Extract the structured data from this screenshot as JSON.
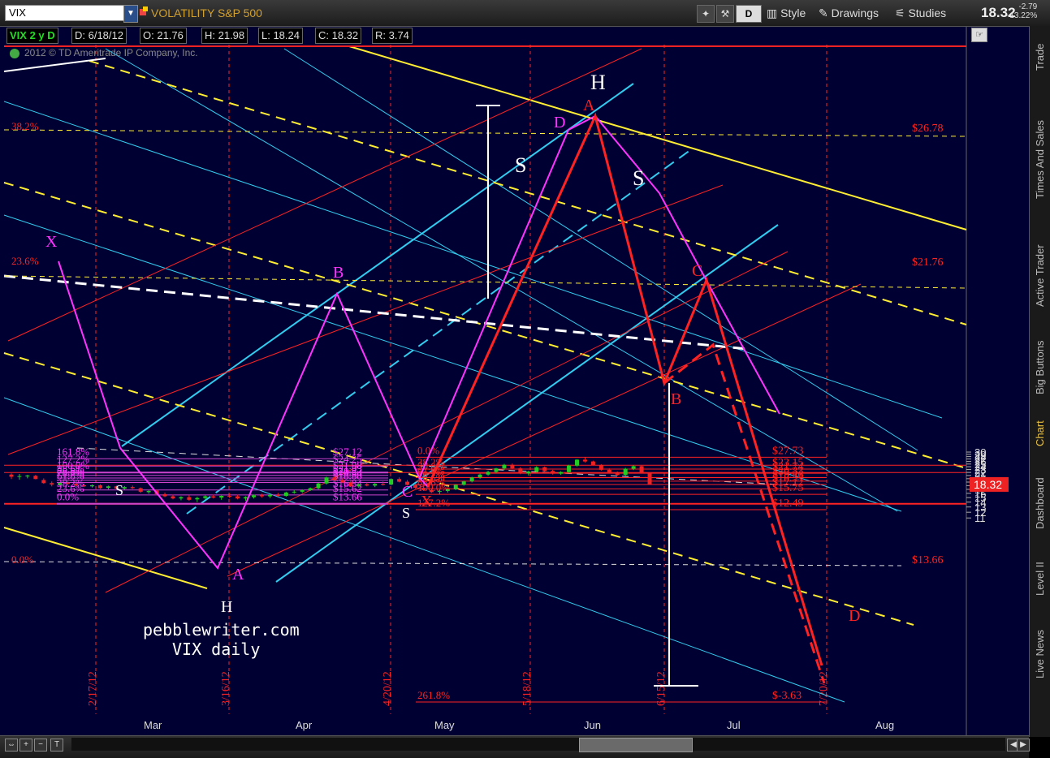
{
  "toolbar": {
    "symbol": "VIX",
    "description": "VOLATILITY S&P 500",
    "style_label": "Style",
    "drawings_label": "Drawings",
    "studies_label": "Studies",
    "last_price": "18.32",
    "net_change": "-2.79",
    "pct_change": "-13.22%",
    "d_button": "D"
  },
  "infobar": {
    "period": "VIX 2 y D",
    "date": "D: 6/18/12",
    "open": "O: 21.76",
    "high": "H: 21.98",
    "low": "L: 18.24",
    "close": "C: 18.32",
    "range": "R: 3.74"
  },
  "copyright": "2012 © TD Ameritrade IP Company, Inc.",
  "rail_tabs": [
    "Trade",
    "Times And Sales",
    "Active Trader",
    "Big Buttons",
    "Chart",
    "Dashboard",
    "Level II",
    "Live News"
  ],
  "colors": {
    "background": "#000033",
    "bull_candle": "#22cc22",
    "bear_candle": "#ee2222",
    "pattern_red": "#ff2222",
    "pattern_magenta": "#ff33ff",
    "channel_cyan": "#33ccee",
    "channel_yellow": "#ffee33",
    "annotation_white": "#ffffff",
    "fib_purple": "#cc44cc"
  },
  "chart_data": {
    "type": "candlestick",
    "title": "VIX daily",
    "watermark": "pebblewriter.com",
    "ylim": [
      11,
      30.5
    ],
    "y_ticks": [
      11,
      12,
      13,
      14,
      15,
      16,
      17,
      18,
      19,
      20,
      21,
      22,
      23,
      24,
      25,
      26,
      27,
      28,
      29,
      30
    ],
    "x_month_labels": [
      "Mar",
      "Apr",
      "May",
      "Jun",
      "Jul",
      "Aug"
    ],
    "x_date_labels": [
      "2/17/12",
      "3/16/12",
      "4/20/12",
      "5/18/12",
      "6/15/12",
      "7/20/12"
    ],
    "current_price_tag": "18.32",
    "fib_left_labels": [
      {
        "pct": "161.8%",
        "price": "$27.12",
        "value": 27.12
      },
      {
        "pct": "127.2%",
        "price": "$24.25",
        "value": 24.25
      },
      {
        "pct": "100.0%",
        "price": "$21.98",
        "value": 21.98
      },
      {
        "pct": "88.6%",
        "price": "$21.03",
        "value": 21.03
      },
      {
        "pct": "78.6%",
        "price": "$20.2",
        "value": 20.2
      },
      {
        "pct": "70.7%",
        "price": "$19.54",
        "value": 19.54
      },
      {
        "pct": "61.8%",
        "price": "$18.88",
        "value": 18.88
      },
      {
        "pct": "38.2%",
        "price": "$16.84",
        "value": 16.84
      },
      {
        "pct": "23.6%",
        "price": "$15.62",
        "value": 15.62
      },
      {
        "pct": "0.0%",
        "price": "$13.66",
        "value": 13.66
      }
    ],
    "fib_right_labels": [
      {
        "pct": "0.0%",
        "price": "$27.73",
        "value": 27.73
      },
      {
        "pct": "38.2%",
        "price": "$23.15",
        "value": 23.15
      },
      {
        "pct": "50.0%",
        "price": "$21.74",
        "value": 21.74
      },
      {
        "pct": "61.8%",
        "price": "$20.33",
        "value": 20.33
      },
      {
        "pct": "70.7%",
        "price": "$19.26",
        "value": 19.26
      },
      {
        "pct": "78.6%",
        "price": "$18.31",
        "value": 18.31
      },
      {
        "pct": "88.6%",
        "price": "$17.12",
        "value": 17.12
      },
      {
        "pct": "100.0%",
        "price": "$15.75",
        "value": 15.75
      },
      {
        "pct": "127.2%",
        "price": "$12.49",
        "value": 12.49
      },
      {
        "pct": "261.8%",
        "price": "$-3.63",
        "value": -3.63
      }
    ],
    "far_left_labels": [
      "38.2%",
      "23.6%",
      "0.0%"
    ],
    "far_right_prices": [
      "$26.78",
      "$21.76",
      "$13.66"
    ],
    "pattern_labels": {
      "left_pattern": [
        "X",
        "A",
        "B",
        "C",
        "D"
      ],
      "right_pattern": [
        "X",
        "A",
        "B",
        "C",
        "D"
      ],
      "head_shoulders": [
        "S",
        "H",
        "S"
      ],
      "inverse_hs": [
        "S",
        "H",
        "S"
      ]
    },
    "candles": [
      [
        21.3,
        21.7,
        19.9,
        20.6
      ],
      [
        20.6,
        21.5,
        19.7,
        20.8
      ],
      [
        20.7,
        21.2,
        20.1,
        21.0
      ],
      [
        20.9,
        21.2,
        19.8,
        19.9
      ],
      [
        19.6,
        20.1,
        18.5,
        18.7
      ],
      [
        18.7,
        19.2,
        17.8,
        18.3
      ],
      [
        18.2,
        19.0,
        17.9,
        18.8
      ],
      [
        18.8,
        19.3,
        18.1,
        18.5
      ],
      [
        18.5,
        19.1,
        17.9,
        18.0
      ],
      [
        18.1,
        18.6,
        17.6,
        17.8
      ],
      [
        17.8,
        18.3,
        17.5,
        18.1
      ],
      [
        18.1,
        18.4,
        17.1,
        17.3
      ],
      [
        17.4,
        18.0,
        17.0,
        17.8
      ],
      [
        17.8,
        18.0,
        17.0,
        17.2
      ],
      [
        17.2,
        17.9,
        16.9,
        17.6
      ],
      [
        17.6,
        18.0,
        17.1,
        17.3
      ],
      [
        17.3,
        17.5,
        16.1,
        16.4
      ],
      [
        16.3,
        16.8,
        15.9,
        16.6
      ],
      [
        16.7,
        17.0,
        15.7,
        15.8
      ],
      [
        15.8,
        16.2,
        15.1,
        15.3
      ],
      [
        15.3,
        15.7,
        14.6,
        14.8
      ],
      [
        14.8,
        15.3,
        14.4,
        15.1
      ],
      [
        15.1,
        15.6,
        14.3,
        14.5
      ],
      [
        14.6,
        15.2,
        14.0,
        14.9
      ],
      [
        14.9,
        15.5,
        14.6,
        15.3
      ],
      [
        15.3,
        15.7,
        14.8,
        15.0
      ],
      [
        15.0,
        15.5,
        14.5,
        15.4
      ],
      [
        15.4,
        15.9,
        14.9,
        15.2
      ],
      [
        15.3,
        15.7,
        14.6,
        14.8
      ],
      [
        14.8,
        15.3,
        14.3,
        15.1
      ],
      [
        15.1,
        15.7,
        14.8,
        15.5
      ],
      [
        15.5,
        15.9,
        15.0,
        15.3
      ],
      [
        15.3,
        15.8,
        14.9,
        15.6
      ],
      [
        15.6,
        16.1,
        15.2,
        15.4
      ],
      [
        15.4,
        16.4,
        15.2,
        16.2
      ],
      [
        16.2,
        16.8,
        15.9,
        16.4
      ],
      [
        16.4,
        17.0,
        16.1,
        16.8
      ],
      [
        16.8,
        17.5,
        16.6,
        17.3
      ],
      [
        17.3,
        18.8,
        17.0,
        18.6
      ],
      [
        18.6,
        20.6,
        18.3,
        20.4
      ],
      [
        20.4,
        21.0,
        19.3,
        19.6
      ],
      [
        19.6,
        20.2,
        18.7,
        18.9
      ],
      [
        18.9,
        19.5,
        17.6,
        17.8
      ],
      [
        17.8,
        18.6,
        17.4,
        18.4
      ],
      [
        18.4,
        18.9,
        17.8,
        18.0
      ],
      [
        18.0,
        18.7,
        17.6,
        18.5
      ],
      [
        18.5,
        19.2,
        18.0,
        18.2
      ],
      [
        18.3,
        20.1,
        18.1,
        19.9
      ],
      [
        19.9,
        20.4,
        18.9,
        19.1
      ],
      [
        19.1,
        19.6,
        18.0,
        18.2
      ],
      [
        18.2,
        18.6,
        17.2,
        17.4
      ],
      [
        17.4,
        17.9,
        16.6,
        16.8
      ],
      [
        16.8,
        17.3,
        16.1,
        16.3
      ],
      [
        16.4,
        16.9,
        15.8,
        16.6
      ],
      [
        16.6,
        17.2,
        16.2,
        17.0
      ],
      [
        17.0,
        18.4,
        16.8,
        18.2
      ],
      [
        18.2,
        19.4,
        18.0,
        19.2
      ],
      [
        19.2,
        20.6,
        18.9,
        20.4
      ],
      [
        20.4,
        21.6,
        20.0,
        21.3
      ],
      [
        21.3,
        22.6,
        20.9,
        22.2
      ],
      [
        22.2,
        23.6,
        21.8,
        23.4
      ],
      [
        23.4,
        25.1,
        22.8,
        24.7
      ],
      [
        24.7,
        25.2,
        23.0,
        23.4
      ],
      [
        23.4,
        23.9,
        21.4,
        21.7
      ],
      [
        21.7,
        22.6,
        21.0,
        22.3
      ],
      [
        22.3,
        24.2,
        22.0,
        23.8
      ],
      [
        23.8,
        24.1,
        22.3,
        22.5
      ],
      [
        22.5,
        22.9,
        21.3,
        21.6
      ],
      [
        21.6,
        22.4,
        21.2,
        22.1
      ],
      [
        22.1,
        24.7,
        21.9,
        24.4
      ],
      [
        24.4,
        26.9,
        24.1,
        26.7
      ],
      [
        26.7,
        27.73,
        25.6,
        26.0
      ],
      [
        26.0,
        26.3,
        24.4,
        24.6
      ],
      [
        24.6,
        24.9,
        22.6,
        22.9
      ],
      [
        22.9,
        23.4,
        21.6,
        21.9
      ],
      [
        21.9,
        22.3,
        20.9,
        21.2
      ],
      [
        21.2,
        23.6,
        20.9,
        23.3
      ],
      [
        23.3,
        24.5,
        22.8,
        24.2
      ],
      [
        24.2,
        24.4,
        21.9,
        22.0
      ],
      [
        21.76,
        21.98,
        18.24,
        18.32
      ]
    ]
  }
}
